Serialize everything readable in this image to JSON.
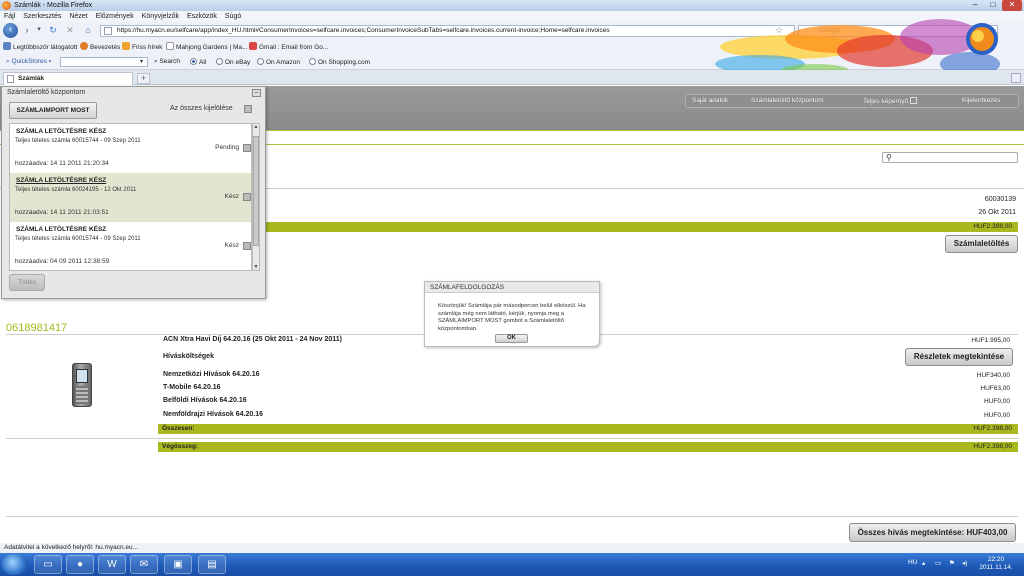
{
  "window": {
    "title": "Számlák - Mozilla Firefox"
  },
  "menu": [
    "Fájl",
    "Szerkesztés",
    "Nézet",
    "Előzmények",
    "Könyvjelzők",
    "Eszközök",
    "Súgó"
  ],
  "url": "https://hu.myacn.eu/selfcare/app/index_HU.html#ConsumerInvoices=selfcare.invoices;ConsumerInvoiceSubTabs=selfcare.invoices.current-invoice;Home=selfcare.invoices",
  "search_placeholder": "Google",
  "bookmarks": [
    "Legtöbbször látogatott",
    "Bevezetés",
    "Friss hírek",
    "Mahjong Gardens | Ma...",
    "Gmail : Email from Go..."
  ],
  "quickstores": {
    "label": "QuickStores",
    "search": "Search",
    "options": [
      "All",
      "On eBay",
      "On Amazon",
      "On Shopping.com"
    ]
  },
  "tab": {
    "label": "Számlák",
    "new_tab": "+"
  },
  "topnav": [
    "Saját adatok",
    "Számlaletöltő központom",
    "Teljes képernyő",
    "Kijelentkezés"
  ],
  "summary": {
    "account": "60030139",
    "date": "26 Okt 2011",
    "amount": "HUF2.398,00",
    "download_button": "Számlaletöltés"
  },
  "phone_number": "0618981417",
  "invoice": {
    "monthly_fee_label": "ACN Xtra Havi Díj  64.20.16 (25 Okt 2011 - 24 Nov 2011)",
    "monthly_fee_amount": "HUF1.995,00",
    "call_costs_label": "Hívásköltségek",
    "details_button": "Részletek megtekintése",
    "lines": [
      {
        "label": "Nemzetközi Hívások 64.20.16",
        "amount": "HUF340,00"
      },
      {
        "label": "T-Mobile 64.20.16",
        "amount": "HUF63,00"
      },
      {
        "label": "Belföldi Hívások 64.20.16",
        "amount": "HUF0,00"
      },
      {
        "label": "Nemföldrajzi Hívások 64.20.16",
        "amount": "HUF0,00"
      }
    ],
    "subtotal_label": "Összesen:",
    "subtotal_amount": "HUF2.398,00",
    "total_label": "Végösszeg:",
    "total_amount": "HUF2.398,00",
    "all_calls_button": "Összes hívás megtekintése: HUF403,00"
  },
  "panel": {
    "title": "Számlaletöltő központom",
    "import_button": "SZÁMLAIMPORT MOST",
    "select_all": "Az összes kijelölése",
    "delete_button": "Törlés",
    "items": [
      {
        "title": "SZÁMLA LETÖLTÉSRE KÉSZ",
        "desc": "Teljes tételes számla 60015744 - 09 Szep 2011",
        "status": "Pending",
        "added": "hozzáadva: 14 11 2011 21:20:34"
      },
      {
        "title": "SZÁMLA LETÖLTÉSRE KÉSZ",
        "desc": "Teljes tételes számla 60024195 - 12 Okt 2011",
        "status": "Kész",
        "added": "hozzáadva: 14 11 2011 21:03:51"
      },
      {
        "title": "SZÁMLA LETÖLTÉSRE KÉSZ",
        "desc": "Teljes tételes számla 60015744 - 09 Szep 2011",
        "status": "Kész",
        "added": "hozzáadva: 04 09 2011 12:38:59"
      }
    ]
  },
  "modal": {
    "title": "SZÁMLAFELDOLGOZÁS",
    "body": "Köszönjük! Számlája pár másodpercen belül elkészül. Ha számlája még nem látható, kérjük, nyomja meg a SZÁMLAIMPORT MOST gombot a Számlaletöltő központomban.",
    "ok": "OK"
  },
  "statusbar": "Adatátvitel a következő helyről: hu.myacn.eu...",
  "taskbar": {
    "lang": "HU",
    "time": "22:20",
    "date": "2011.11.14."
  }
}
